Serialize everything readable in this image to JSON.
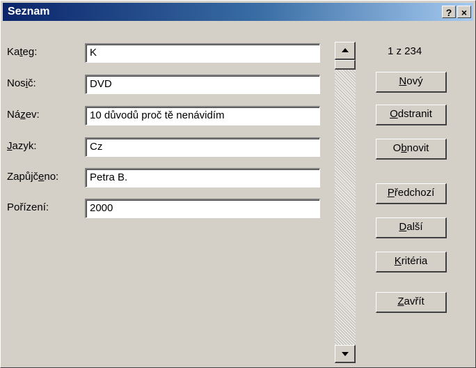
{
  "window": {
    "title": "Seznam",
    "help_button": "?",
    "close_button": "×"
  },
  "fields": [
    {
      "label_pre": "Ka",
      "label_key": "t",
      "label_post": "eg:",
      "value": "K"
    },
    {
      "label_pre": "Nos",
      "label_key": "i",
      "label_post": "č:",
      "value": "DVD"
    },
    {
      "label_pre": "Ná",
      "label_key": "z",
      "label_post": "ev:",
      "value": "10 důvodů proč tě nenávidím"
    },
    {
      "label_pre": "",
      "label_key": "J",
      "label_post": "azyk:",
      "value": "Cz"
    },
    {
      "label_pre": "Zapůjč",
      "label_key": "e",
      "label_post": "no:",
      "value": "Petra B."
    },
    {
      "label_pre": "Pořízení:",
      "label_key": "",
      "label_post": "",
      "value": "2000"
    }
  ],
  "record_counter": "1 z 234",
  "buttons": {
    "new": {
      "pre": "",
      "key": "N",
      "post": "ový"
    },
    "delete": {
      "pre": "",
      "key": "O",
      "post": "dstranit"
    },
    "restore": {
      "pre": "O",
      "key": "b",
      "post": "novit"
    },
    "previous": {
      "pre": "",
      "key": "P",
      "post": "ředchozí"
    },
    "next": {
      "pre": "",
      "key": "D",
      "post": "alší"
    },
    "criteria": {
      "pre": "",
      "key": "K",
      "post": "ritéria"
    },
    "close": {
      "pre": "",
      "key": "Z",
      "post": "avřít"
    }
  },
  "icons": {
    "scroll_up": "up-arrow-icon",
    "scroll_down": "down-arrow-icon"
  },
  "colors": {
    "titlebar_start": "#0a246a",
    "titlebar_end": "#a6caf0",
    "face": "#d4d0c8"
  }
}
